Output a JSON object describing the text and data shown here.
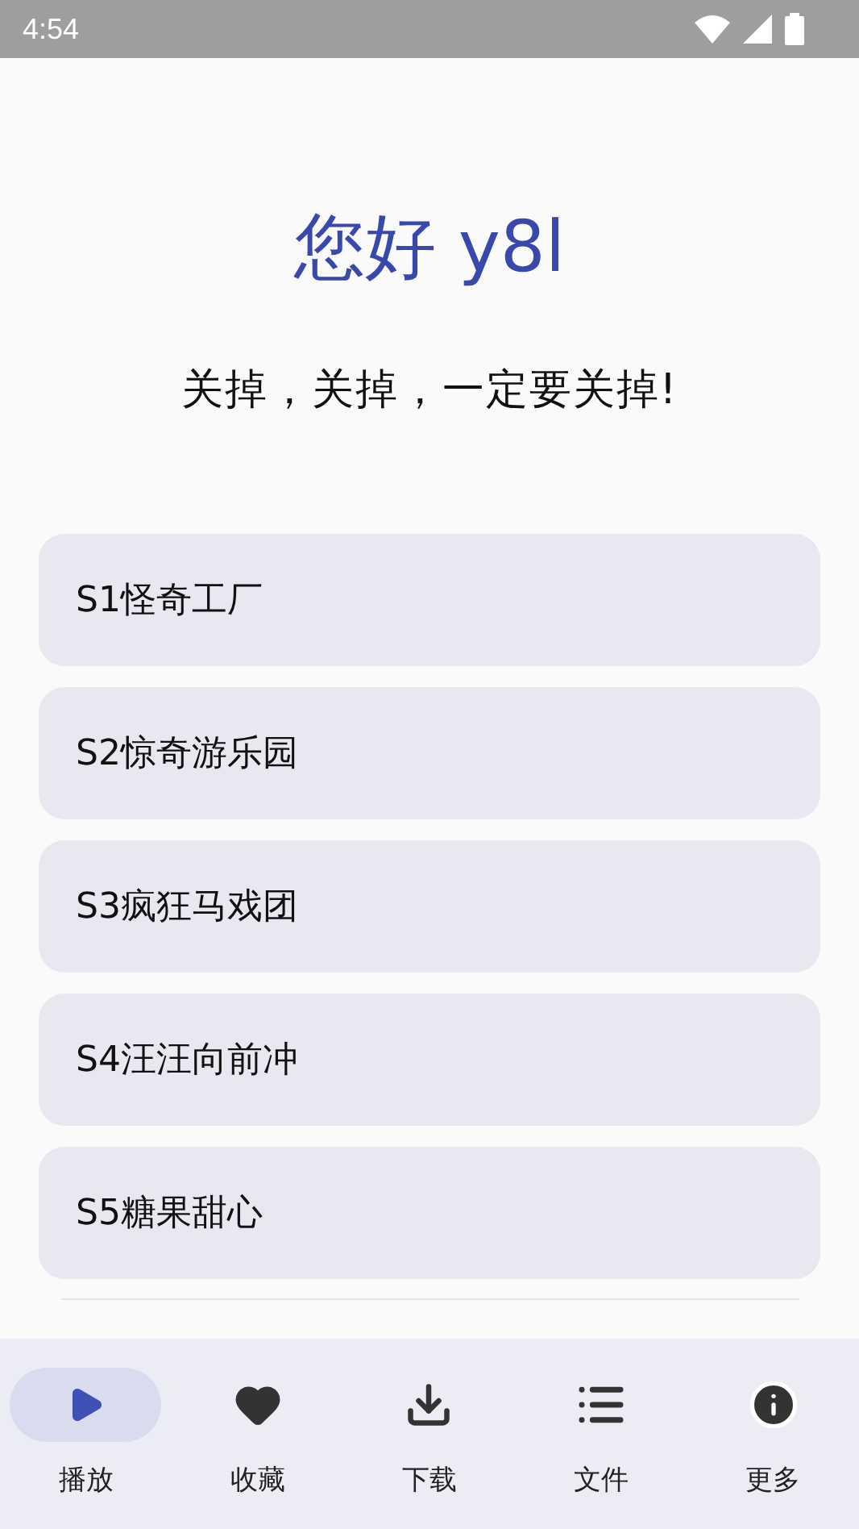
{
  "status_bar": {
    "time": "4:54"
  },
  "title": "您好 y8l",
  "subtitle": "关掉，关掉，一定要关掉!",
  "episodes": [
    {
      "label": "S1怪奇工厂"
    },
    {
      "label": "S2惊奇游乐园"
    },
    {
      "label": "S3疯狂马戏团"
    },
    {
      "label": "S4汪汪向前冲"
    },
    {
      "label": "S5糖果甜心"
    }
  ],
  "nav": [
    {
      "label": "播放",
      "selected": true
    },
    {
      "label": "收藏",
      "selected": false
    },
    {
      "label": "下载",
      "selected": false
    },
    {
      "label": "文件",
      "selected": false
    },
    {
      "label": "更多",
      "selected": false
    }
  ]
}
